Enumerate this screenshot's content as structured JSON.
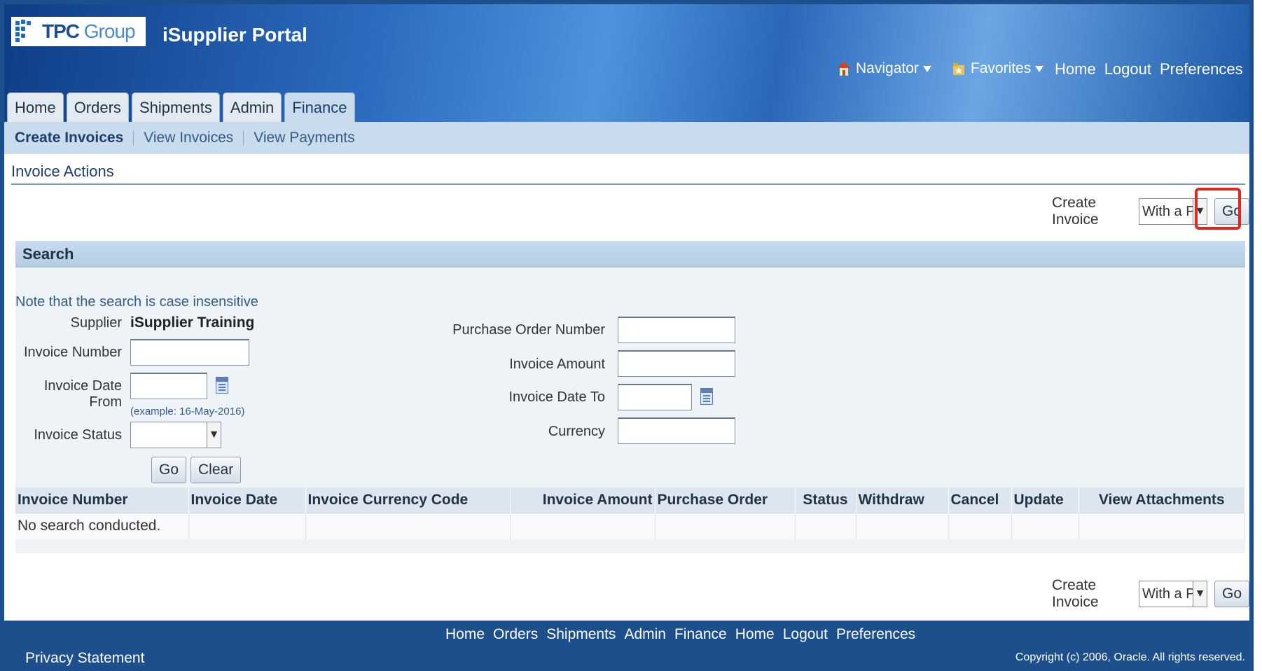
{
  "header": {
    "logo_brand_bold": "TPC",
    "logo_brand_light": " Group",
    "app_title": "iSupplier Portal",
    "navigator_label": "Navigator",
    "favorites_label": "Favorites",
    "top_links": [
      "Home",
      "Logout",
      "Preferences"
    ]
  },
  "tabs": [
    {
      "label": "Home",
      "active": false
    },
    {
      "label": "Orders",
      "active": false
    },
    {
      "label": "Shipments",
      "active": false
    },
    {
      "label": "Admin",
      "active": false
    },
    {
      "label": "Finance",
      "active": true
    }
  ],
  "subtabs": [
    {
      "label": "Create Invoices",
      "active": true
    },
    {
      "label": "View Invoices",
      "active": false
    },
    {
      "label": "View Payments",
      "active": false
    }
  ],
  "invoice_actions": {
    "title": "Invoice Actions",
    "create_invoice_label": "Create Invoice",
    "create_invoice_value": "With a PO",
    "go_label": "Go"
  },
  "search": {
    "title": "Search",
    "note": "Note that the search is case insensitive",
    "supplier_label": "Supplier",
    "supplier_value": "iSupplier Training",
    "invoice_number_label": "Invoice Number",
    "invoice_date_from_label": "Invoice Date From",
    "date_example": "(example: 16-May-2016)",
    "invoice_status_label": "Invoice Status",
    "po_number_label": "Purchase Order Number",
    "invoice_amount_label": "Invoice Amount",
    "invoice_date_to_label": "Invoice Date To",
    "currency_label": "Currency",
    "go_label": "Go",
    "clear_label": "Clear"
  },
  "results": {
    "columns": [
      "Invoice Number",
      "Invoice Date",
      "Invoice Currency Code",
      "Invoice Amount",
      "Purchase Order",
      "Status",
      "Withdraw",
      "Cancel",
      "Update",
      "View Attachments"
    ],
    "empty_message": "No search conducted."
  },
  "footer": {
    "links": [
      "Home",
      "Orders",
      "Shipments",
      "Admin",
      "Finance",
      "Home",
      "Logout",
      "Preferences"
    ],
    "privacy": "Privacy Statement",
    "copyright": "Copyright (c) 2006, Oracle. All rights reserved."
  },
  "colors": {
    "header_blue": "#1c4f8c",
    "tab_active": "#c9dcee",
    "highlight_red": "#e0281c"
  }
}
